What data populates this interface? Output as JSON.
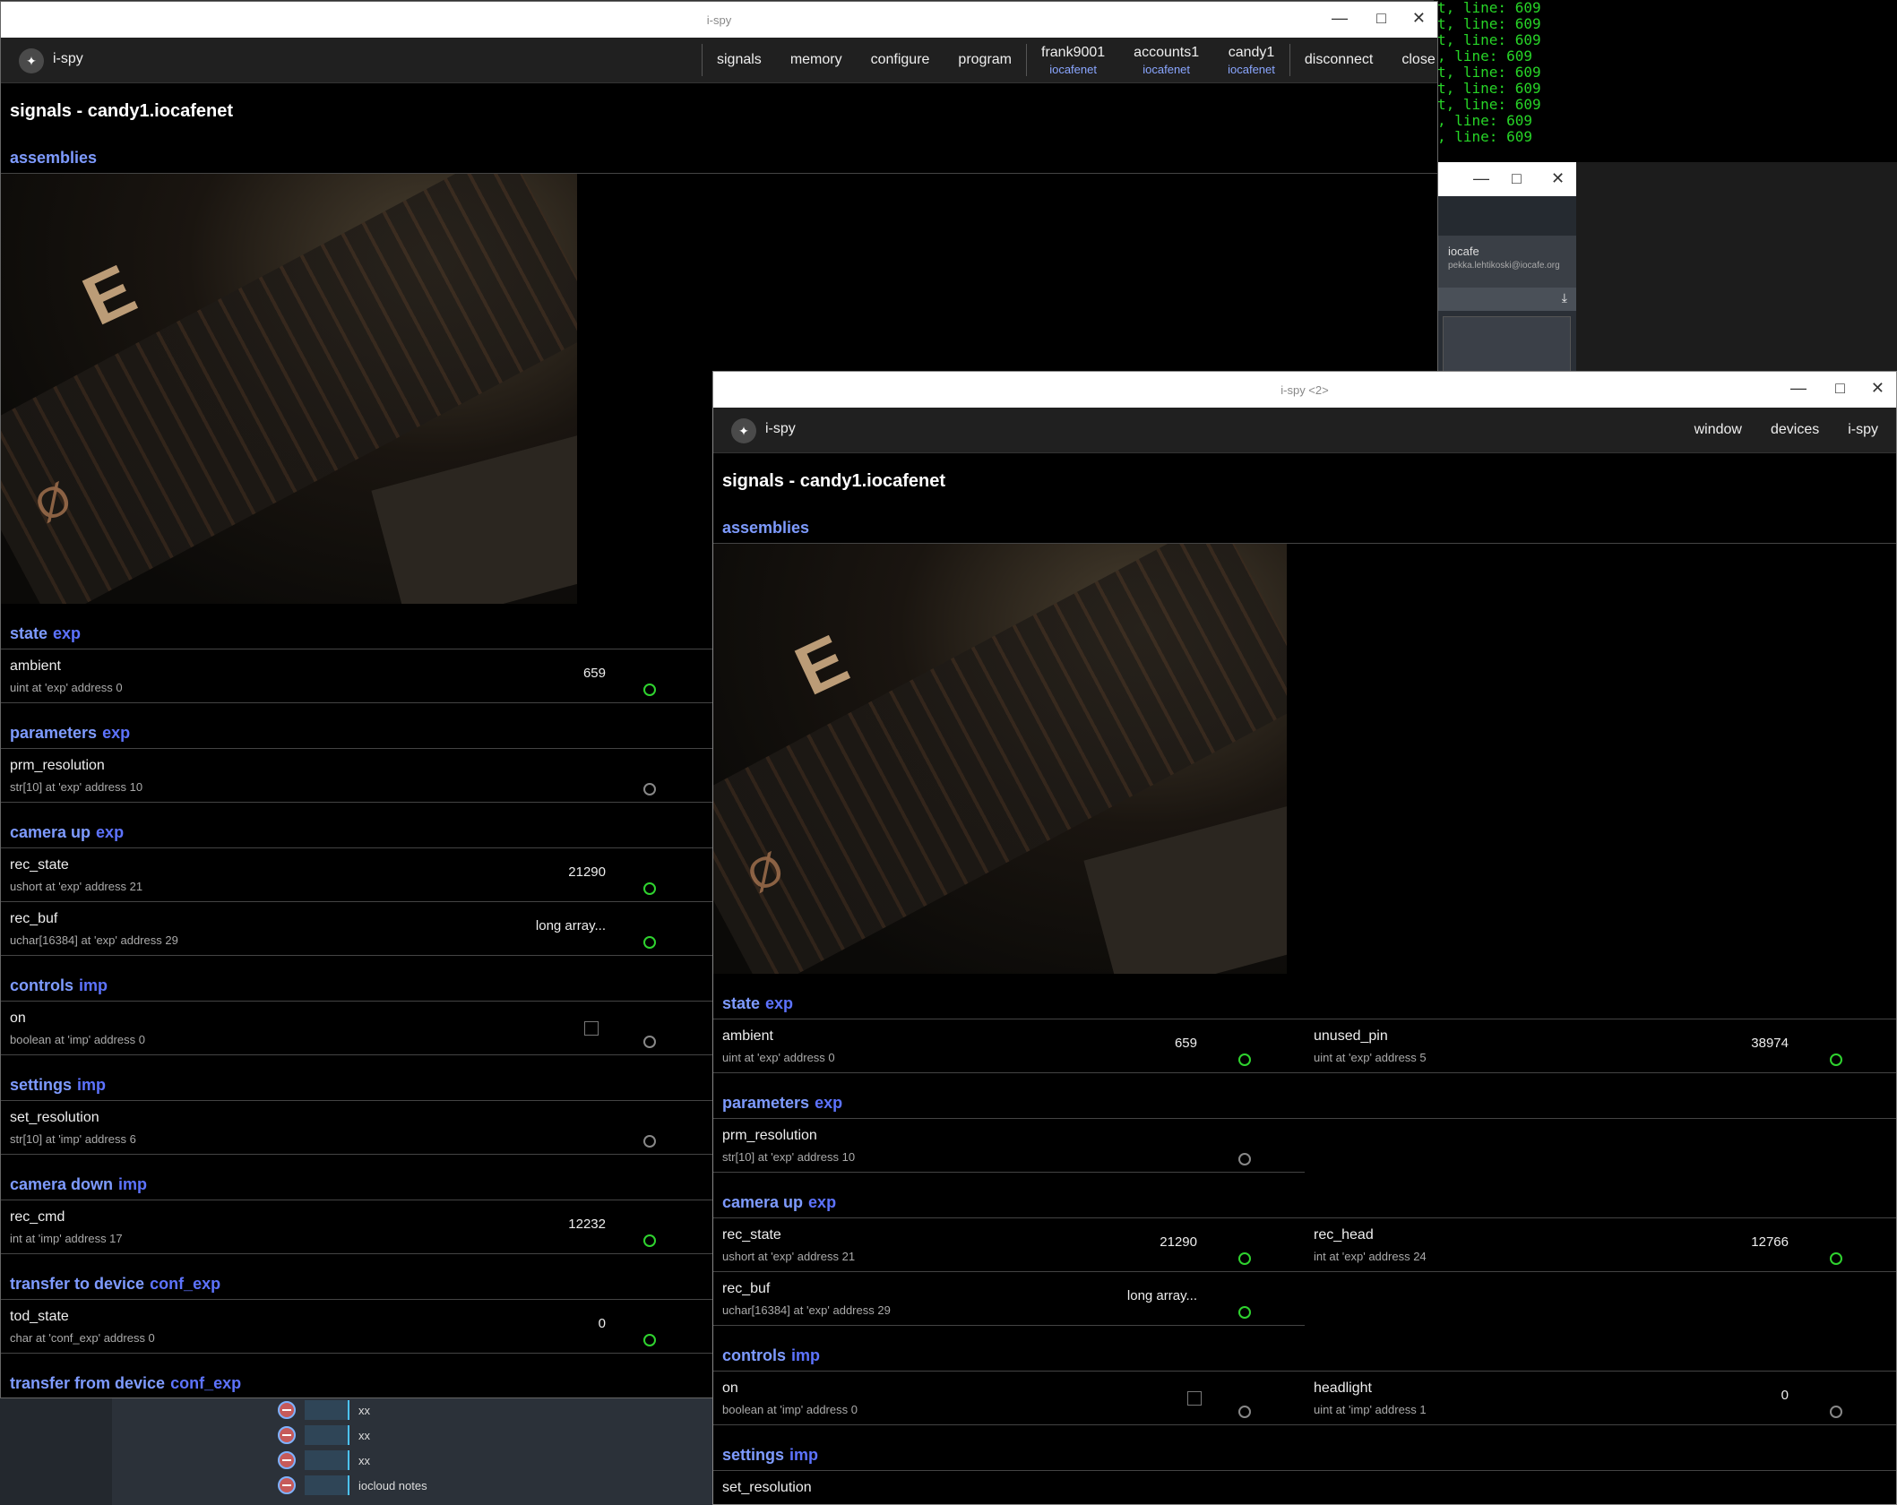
{
  "terminal": {
    "lines": [
      "t, line: 609",
      "t, line: 609",
      "t, line: 609",
      ", line: 609",
      "t, line: 609",
      "t, line: 609",
      "t, line: 609",
      ", line: 609",
      ", line: 609"
    ]
  },
  "bg_window": {
    "account_name": "iocafe",
    "account_email": "pekka.lehtikoski@iocafe.org",
    "download_icon": "download-icon"
  },
  "bottom_panel": {
    "items": [
      "xx",
      "xx",
      "xx",
      "iocloud notes"
    ]
  },
  "window1": {
    "title": "i-spy",
    "app_name": "i-spy",
    "nav": {
      "signals": "signals",
      "memory": "memory",
      "configure": "configure",
      "program": "program",
      "devices": [
        {
          "name": "frank9001",
          "net": "iocafenet"
        },
        {
          "name": "accounts1",
          "net": "iocafenet"
        },
        {
          "name": "candy1",
          "net": "iocafenet"
        }
      ],
      "disconnect": "disconnect",
      "close": "close"
    },
    "page_title": "signals -  candy1.iocafenet",
    "assemblies": "assemblies",
    "sections": [
      {
        "title": "state",
        "tag": "exp",
        "rows": [
          {
            "name": "ambient",
            "desc": "uint at 'exp' address 0",
            "value": "659",
            "status": "ok"
          }
        ]
      },
      {
        "title": "parameters",
        "tag": "exp",
        "rows": [
          {
            "name": "prm_resolution",
            "desc": "str[10] at 'exp' address 10",
            "value": "",
            "status": "idle"
          }
        ]
      },
      {
        "title": "camera up",
        "tag": "exp",
        "rows": [
          {
            "name": "rec_state",
            "desc": "ushort at 'exp' address 21",
            "value": "21290",
            "status": "ok"
          },
          {
            "name": "rec_buf",
            "desc": "uchar[16384] at 'exp' address 29",
            "value": "long array...",
            "status": "ok"
          }
        ]
      },
      {
        "title": "controls",
        "tag": "imp",
        "rows": [
          {
            "name": "on",
            "desc": "boolean at 'imp' address 0",
            "value": "",
            "checkbox": true,
            "status": "idle"
          }
        ]
      },
      {
        "title": "settings",
        "tag": "imp",
        "rows": [
          {
            "name": "set_resolution",
            "desc": "str[10] at 'imp' address 6",
            "value": "",
            "status": "idle"
          }
        ]
      },
      {
        "title": "camera down",
        "tag": "imp",
        "rows": [
          {
            "name": "rec_cmd",
            "desc": "int at 'imp' address 17",
            "value": "12232",
            "status": "ok"
          }
        ]
      },
      {
        "title": "transfer to device",
        "tag": "conf_exp",
        "rows": [
          {
            "name": "tod_state",
            "desc": "char at 'conf_exp' address 0",
            "value": "0",
            "status": "ok"
          }
        ]
      },
      {
        "title": "transfer from device",
        "tag": "conf_exp",
        "rows": []
      }
    ]
  },
  "window2": {
    "title": "i-spy <2>",
    "app_name": "i-spy",
    "menus": [
      "window",
      "devices",
      "i-spy"
    ],
    "page_title": "signals -  candy1.iocafenet",
    "assemblies": "assemblies",
    "state": {
      "title": "state",
      "tag": "exp",
      "left": {
        "name": "ambient",
        "desc": "uint at 'exp' address 0",
        "value": "659"
      },
      "right": {
        "name": "unused_pin",
        "desc": "uint at 'exp' address 5",
        "value": "38974"
      }
    },
    "parameters": {
      "title": "parameters",
      "tag": "exp",
      "left": {
        "name": "prm_resolution",
        "desc": "str[10] at 'exp' address 10",
        "value": ""
      }
    },
    "camera_up": {
      "title": "camera up",
      "tag": "exp",
      "r1l": {
        "name": "rec_state",
        "desc": "ushort at 'exp' address 21",
        "value": "21290"
      },
      "r1r": {
        "name": "rec_head",
        "desc": "int at 'exp' address 24",
        "value": "12766"
      },
      "r2l": {
        "name": "rec_buf",
        "desc": "uchar[16384] at 'exp' address 29",
        "value": "long array..."
      }
    },
    "controls": {
      "title": "controls",
      "tag": "imp",
      "left": {
        "name": "on",
        "desc": "boolean at 'imp' address 0"
      },
      "right": {
        "name": "headlight",
        "desc": "uint at 'imp' address 1",
        "value": "0"
      }
    },
    "settings": {
      "title": "settings",
      "tag": "imp",
      "left": {
        "name": "set_resolution"
      }
    }
  }
}
